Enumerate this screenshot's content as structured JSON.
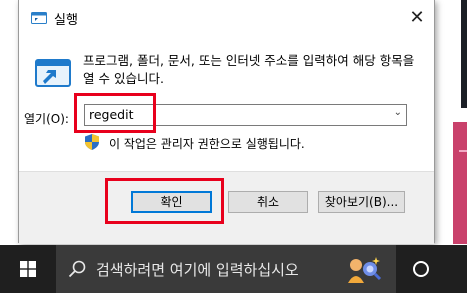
{
  "dialog": {
    "title": "실행",
    "description": "프로그램, 폴더, 문서, 또는 인터넷 주소를 입력하여 해당 항목을 열 수 있습니다.",
    "open_label": "열기(O):",
    "input_value": "regedit",
    "admin_note": "이 작업은 관리자 권한으로 실행됩니다.",
    "buttons": {
      "ok": "확인",
      "cancel": "취소",
      "browse": "찾아보기(B)..."
    }
  },
  "taskbar": {
    "search_placeholder": "검색하려면 여기에 입력하십시오"
  },
  "colors": {
    "highlight": "#e8001c",
    "accent": "#0078d7",
    "taskbar": "#1f1f1f",
    "search_box": "#3a3a3a"
  },
  "icons": [
    "run-dialog-icon",
    "close-icon",
    "run-program-icon",
    "dropdown-arrow-icon",
    "uac-shield-icon",
    "windows-logo-icon",
    "search-icon",
    "cortana-icon",
    "task-view-icon"
  ]
}
